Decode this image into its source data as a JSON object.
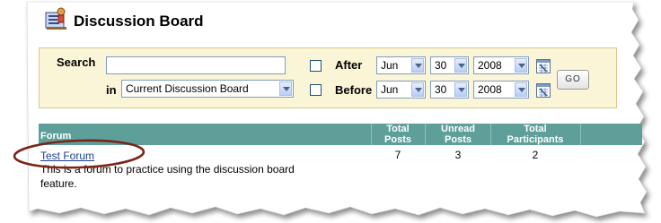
{
  "page": {
    "title": "Discussion Board",
    "title_icon": "discussion-board-icon"
  },
  "search": {
    "label": "Search",
    "input_value": "",
    "in_label": "in",
    "scope_value": "Current Discussion Board",
    "after_label": "After",
    "before_label": "Before",
    "after": {
      "month": "Jun",
      "day": "30",
      "year": "2008",
      "checked": false
    },
    "before": {
      "month": "Jun",
      "day": "30",
      "year": "2008",
      "checked": false
    },
    "calendar_icon": "calendar-icon",
    "go_label": "GO"
  },
  "table": {
    "headers": {
      "forum": "Forum",
      "total_posts": [
        "Total",
        "Posts"
      ],
      "unread_posts": [
        "Unread",
        "Posts"
      ],
      "total_participants": [
        "Total",
        "Participants"
      ]
    },
    "rows": [
      {
        "name": "Test Forum",
        "description_line1": "This is a forum to practice using the discussion board",
        "description_line2": "feature.",
        "total_posts": "7",
        "unread_posts": "3",
        "total_participants": "2"
      }
    ]
  },
  "colors": {
    "header_bg": "#5f9f9a",
    "search_bg": "#fbf5d8",
    "annotation": "#7b2418",
    "link": "#1a3f8c"
  }
}
